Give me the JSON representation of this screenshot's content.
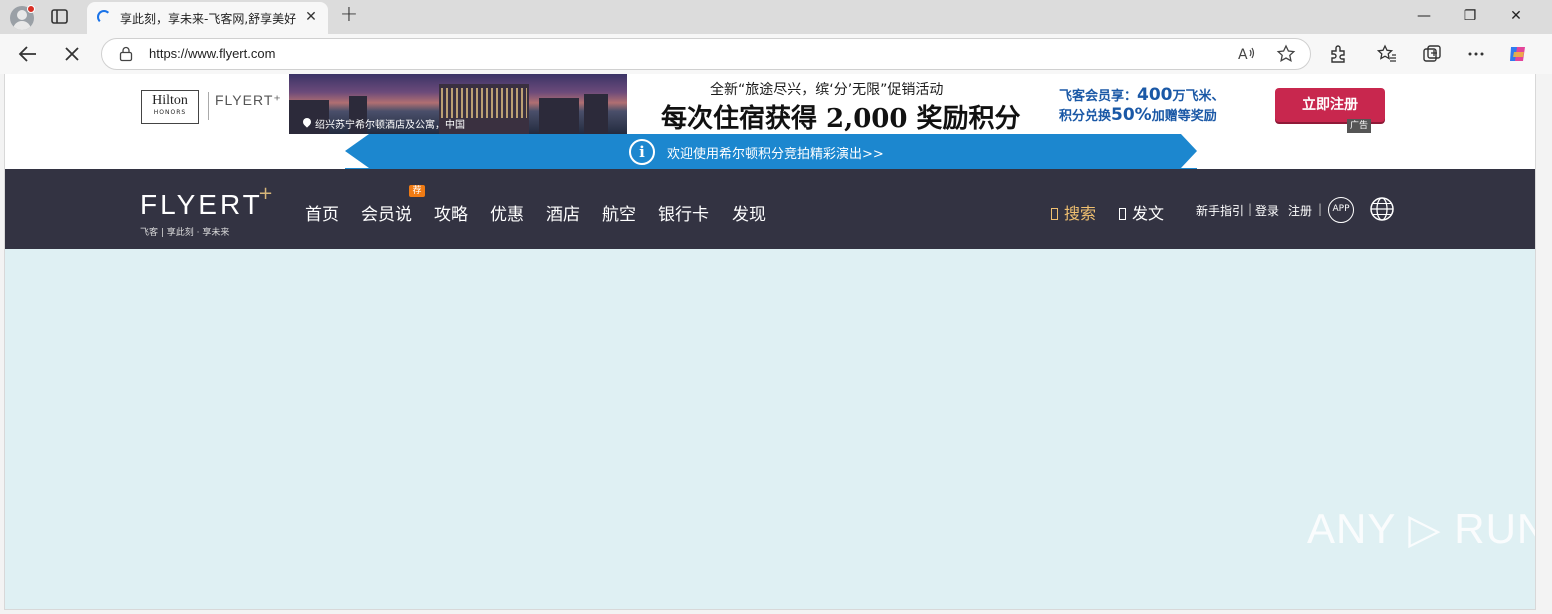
{
  "browser": {
    "tab_title": "享此刻，享未来-飞客网,舒享美好",
    "tab_close": "✕",
    "new_tab": "+",
    "url": "https://www.flyert.com",
    "window_minimize": "—",
    "window_restore": "❐",
    "window_close": "✕"
  },
  "ad": {
    "hilton": "Hilton",
    "honors": "HONORS",
    "flyert": "FLYERT⁺",
    "photo_caption": "绍兴苏宁希尔顿酒店及公寓，中国",
    "headline_small": "全新“旅途尽兴，缤‘分’无限”促销活动",
    "headline_big": "每次住宿获得 2,000 奖励积分",
    "member_line1_prefix": "飞客会员享：",
    "member_line1_highlight": "400",
    "member_line1_suffix": "万飞米、",
    "member_line2_prefix": "积分兑换",
    "member_line2_highlight": "50%",
    "member_line2_suffix": "加赠等奖励",
    "cta": "立即注册",
    "tag": "广告"
  },
  "notice": {
    "icon_glyph": "i",
    "text": "欢迎使用希尔顿积分竞拍精彩演出>>"
  },
  "nav": {
    "logo": "FLYERT",
    "logo_plus": "+",
    "logo_sub": "飞客 | 享此刻 · 享未来",
    "items": [
      "首页",
      "会员说",
      "攻略",
      "优惠",
      "酒店",
      "航空",
      "银行卡",
      "发现"
    ],
    "badge": "荐",
    "search": "搜索",
    "post": "发文",
    "guide": "新手指引",
    "login": "登录",
    "register": "注册",
    "app": "APP"
  },
  "watermark": "ANY ▷ RUN"
}
